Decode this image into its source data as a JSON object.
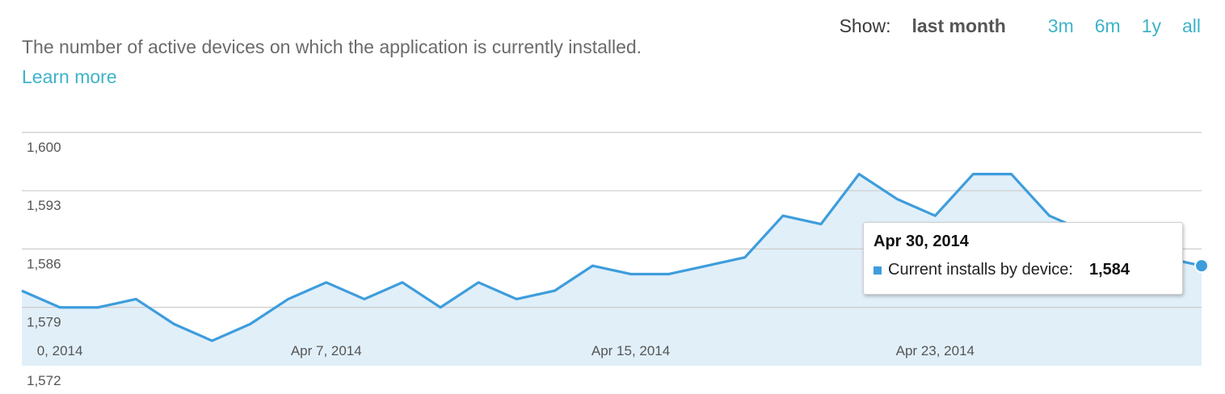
{
  "description": "The number of active devices on which the application is currently installed.",
  "learn_more": "Learn more",
  "range_selector": {
    "label": "Show:",
    "active": "last month",
    "options": [
      "3m",
      "6m",
      "1y",
      "all"
    ]
  },
  "chart_data": {
    "type": "area",
    "series": [
      {
        "name": "Current installs by device",
        "x": [
          "Mar 30, 2014",
          "Mar 31, 2014",
          "Apr 1, 2014",
          "Apr 2, 2014",
          "Apr 3, 2014",
          "Apr 4, 2014",
          "Apr 5, 2014",
          "Apr 6, 2014",
          "Apr 7, 2014",
          "Apr 8, 2014",
          "Apr 9, 2014",
          "Apr 10, 2014",
          "Apr 11, 2014",
          "Apr 12, 2014",
          "Apr 13, 2014",
          "Apr 14, 2014",
          "Apr 15, 2014",
          "Apr 16, 2014",
          "Apr 17, 2014",
          "Apr 18, 2014",
          "Apr 19, 2014",
          "Apr 20, 2014",
          "Apr 21, 2014",
          "Apr 22, 2014",
          "Apr 23, 2014",
          "Apr 24, 2014",
          "Apr 25, 2014",
          "Apr 26, 2014",
          "Apr 27, 2014",
          "Apr 28, 2014",
          "Apr 29, 2014",
          "Apr 30, 2014"
        ],
        "values": [
          1581,
          1579,
          1579,
          1580,
          1577,
          1575,
          1577,
          1580,
          1582,
          1580,
          1582,
          1579,
          1582,
          1580,
          1581,
          1584,
          1583,
          1583,
          1584,
          1585,
          1590,
          1589,
          1595,
          1592,
          1590,
          1595,
          1595,
          1590,
          1588,
          1586,
          1585,
          1584
        ]
      }
    ],
    "x_tick_labels": [
      "0, 2014",
      "Apr 7, 2014",
      "Apr 15, 2014",
      "Apr 23, 2014"
    ],
    "y_tick_labels": [
      "1,600",
      "1,593",
      "1,586",
      "1,579",
      "1,572"
    ],
    "ylim": [
      1572,
      1600
    ],
    "grid": true,
    "color": "#3e9ddc",
    "fill_color": "#e1eff9"
  },
  "tooltip": {
    "date": "Apr 30, 2014",
    "series_label": "Current installs by device:",
    "value": "1,584"
  }
}
